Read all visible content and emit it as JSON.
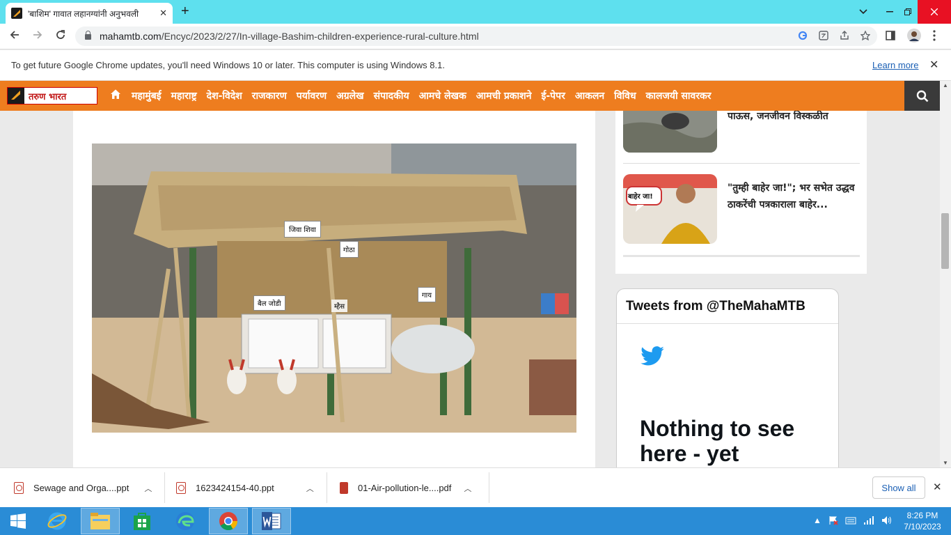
{
  "browser": {
    "tab_title": "'बाशिम' गावात लहानग्यांनी अनुभवली",
    "tab_close": "✕",
    "new_tab": "+",
    "url_domain": "mahamtb.com",
    "url_path": "/Encyc/2023/2/27/In-village-Bashim-children-experience-rural-culture.html"
  },
  "infobar": {
    "message": "To get future Google Chrome updates, you'll need Windows 10 or later. This computer is using Windows 8.1.",
    "learn_more": "Learn more",
    "close": "✕"
  },
  "site": {
    "logo_text": "तरुण भारत",
    "nav_items": [
      "महामुंबई",
      "महाराष्ट्र",
      "देश-विदेश",
      "राजकारण",
      "पर्यावरण",
      "अग्रलेख",
      "संपादकीय",
      "आमचे लेखक",
      "आमची प्रकाशने",
      "ई-पेपर",
      "आकलन",
      "विविध",
      "कालजयी सावरकर"
    ]
  },
  "sidebar": {
    "news": [
      {
        "title": "पाऊस, जनजीवन विस्कळीत"
      },
      {
        "title": "\"तुम्ही बाहेर जा!\"; भर सभेत उद्धव ठाकरेंची पत्रकाराला बाहेर...",
        "thumb_label": "बाहेर जा!"
      }
    ]
  },
  "photo": {
    "signs": [
      "जिवा शिवा",
      "गोठा",
      "बैल जोडी",
      "म्हैस",
      "गाय"
    ]
  },
  "tweets": {
    "header": "Tweets from @TheMahaMTB",
    "empty_message": "Nothing to see here - yet"
  },
  "downloads": {
    "items": [
      {
        "name": "Sewage and Orga....ppt"
      },
      {
        "name": "1623424154-40.ppt"
      },
      {
        "name": "01-Air-pollution-le....pdf"
      }
    ],
    "show_all": "Show all"
  },
  "taskbar": {
    "time": "8:26 PM",
    "date": "7/10/2023"
  },
  "colors": {
    "nav_orange": "#ee7d1f",
    "tab_strip": "#5ee0ee",
    "taskbar": "#2a8cd6"
  }
}
